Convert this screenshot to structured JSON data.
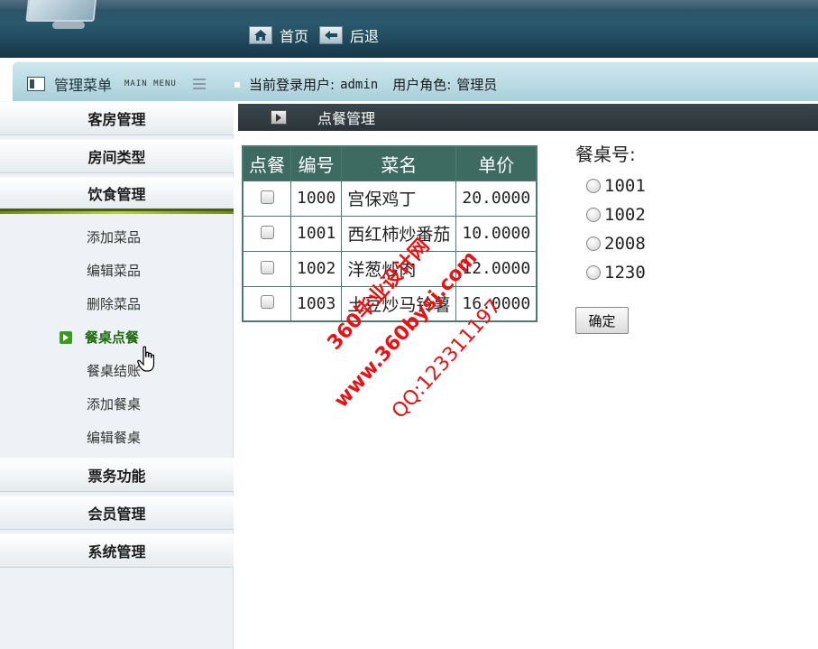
{
  "topnav": {
    "home_label": "首页",
    "back_label": "后退"
  },
  "band": {
    "menu_title": "管理菜单",
    "menu_title_en": "MAIN MENU",
    "current_user_label": "当前登录用户:",
    "current_user": "admin",
    "role_label": "用户角色:",
    "role": "管理员"
  },
  "sidebar": {
    "sections": [
      {
        "label": "客房管理"
      },
      {
        "label": "房间类型"
      },
      {
        "label": "饮食管理"
      }
    ],
    "sub_items": [
      {
        "label": "添加菜品"
      },
      {
        "label": "编辑菜品"
      },
      {
        "label": "删除菜品"
      },
      {
        "label": "餐桌点餐"
      },
      {
        "label": "餐桌结账"
      },
      {
        "label": "添加餐桌"
      },
      {
        "label": "编辑餐桌"
      }
    ],
    "bottom_sections": [
      {
        "label": "票务功能"
      },
      {
        "label": "会员管理"
      },
      {
        "label": "系统管理"
      }
    ],
    "current_sub": "餐桌点餐"
  },
  "content": {
    "breadcrumb": "点餐管理",
    "table": {
      "headers": [
        "点餐",
        "编号",
        "菜名",
        "单价"
      ],
      "rows": [
        {
          "id": "1000",
          "name": "宫保鸡丁",
          "price": "20.0000"
        },
        {
          "id": "1001",
          "name": "西红柿炒番茄",
          "price": "10.0000"
        },
        {
          "id": "1002",
          "name": "洋葱炒肉",
          "price": "12.0000"
        },
        {
          "id": "1003",
          "name": "土豆炒马铃薯",
          "price": "16.0000"
        }
      ]
    },
    "table_no_label": "餐桌号:",
    "table_numbers": [
      "1001",
      "1002",
      "2008",
      "1230"
    ],
    "confirm_label": "确定"
  },
  "watermark": {
    "line1": "360毕业设计网",
    "line2": "www.360bysj.com",
    "line3": "QQ:123311197"
  },
  "colors": {
    "accent_green": "#3d6b62",
    "watermark": "#e81212",
    "breadcrumb_bg": "#2b3439"
  }
}
